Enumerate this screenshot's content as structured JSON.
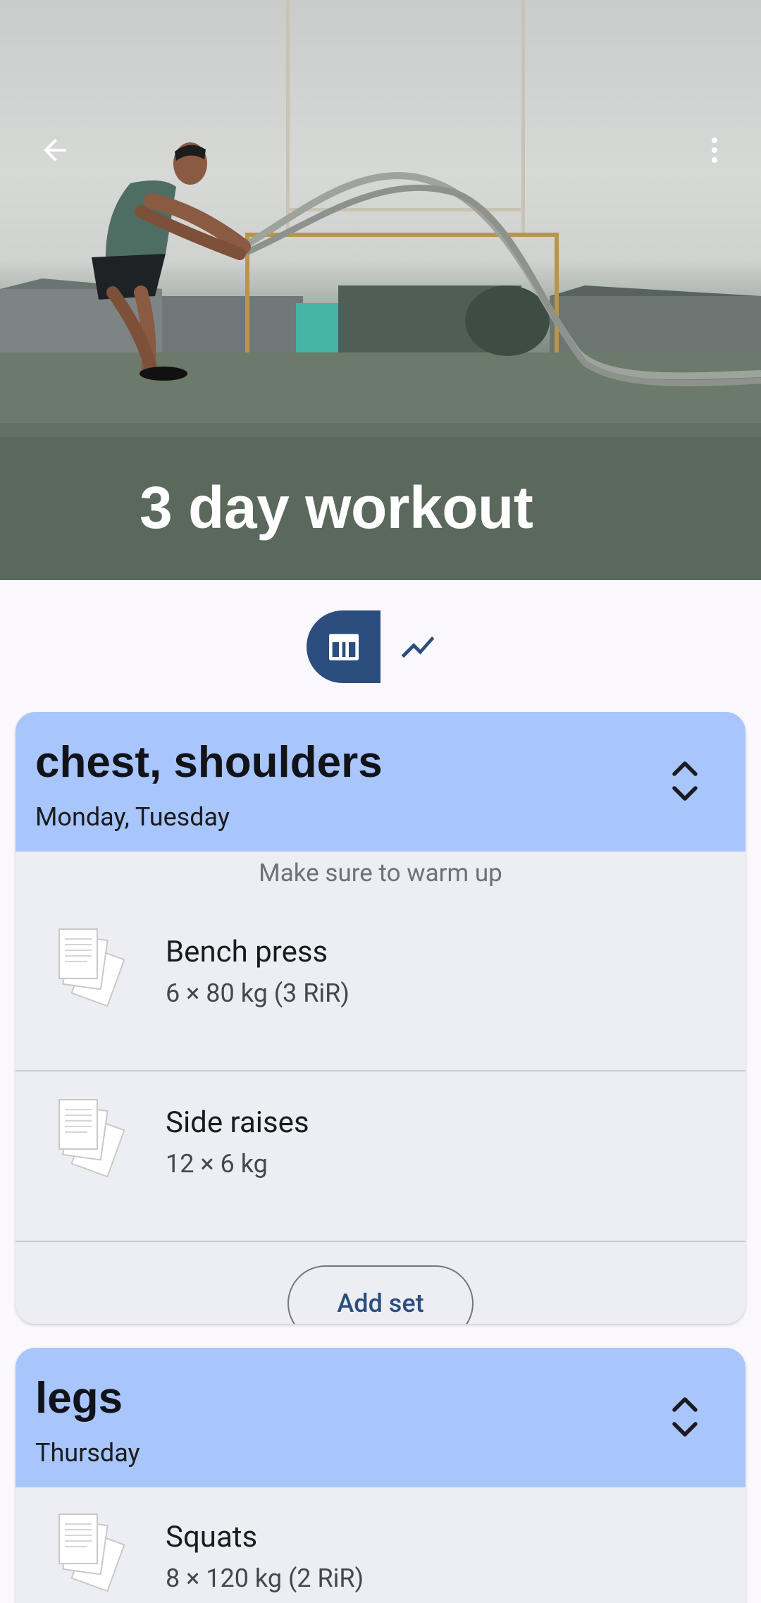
{
  "hero": {
    "title": "3 day workout",
    "back_icon": "arrow-left-icon",
    "menu_icon": "more-vert-icon"
  },
  "view_toggle": {
    "options": [
      {
        "icon": "table-icon",
        "selected": true
      },
      {
        "icon": "chart-line-icon",
        "selected": false
      }
    ],
    "accent": "#2c4e7e"
  },
  "days": [
    {
      "title": "chest, shoulders",
      "subtitle": "Monday, Tuesday",
      "note": "Make sure to warm up",
      "exercises": [
        {
          "name": "Bench press",
          "detail": "6 × 80 kg  (3 RiR)",
          "icon": "documents-icon"
        },
        {
          "name": "Side raises",
          "detail": "12 × 6 kg",
          "icon": "documents-icon"
        }
      ],
      "add_set_label": "Add set"
    },
    {
      "title": "legs",
      "subtitle": "Thursday",
      "exercises": [
        {
          "name": "Squats",
          "detail": "8 × 120 kg  (2 RiR)",
          "icon": "documents-icon"
        }
      ]
    }
  ],
  "colors": {
    "header_bg": "#a8c6fc",
    "card_bg": "#eceef4",
    "page_bg": "#fbf8fd"
  }
}
